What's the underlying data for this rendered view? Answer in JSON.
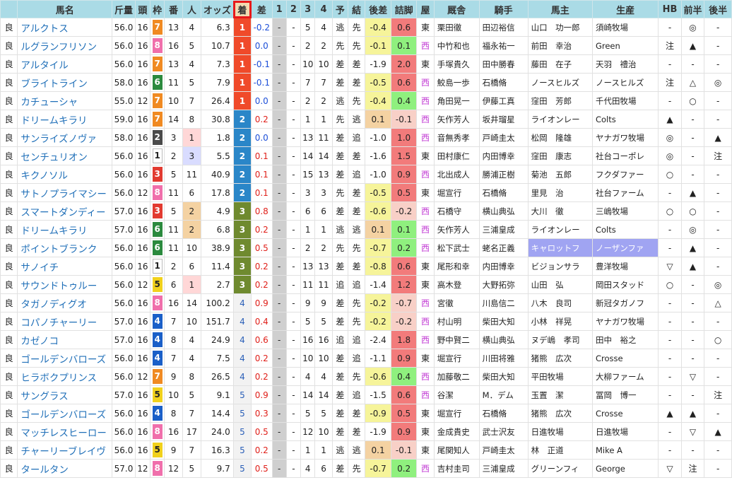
{
  "headers": [
    "馬名",
    "斤量",
    "頭",
    "枠",
    "番",
    "人",
    "オッズ",
    "着",
    "差",
    "1",
    "2",
    "3",
    "4",
    "予",
    "結",
    "後差",
    "詰脚",
    "屋",
    "厩舎",
    "騎手",
    "馬主",
    "生産",
    "HB",
    "前半",
    "後半"
  ],
  "sorted_column": "着",
  "colors": {
    "header": "#aadbe6",
    "sorted_header": "#f2d9b0",
    "sort_outline": "#e8181a",
    "link": "#1f6fb8",
    "west": "#c23bd4"
  },
  "rows": [
    {
      "ground": "良",
      "name": "アルクトス",
      "weight": "56.0",
      "heads": "16",
      "gate": "7",
      "num": "13",
      "pop": "4",
      "odds": "6.3",
      "finish": "1",
      "diff": "-0.2",
      "c1": "-",
      "c2": "-",
      "c3": "5",
      "c4": "4",
      "yosou": "逃",
      "kekka": "先",
      "atosa": "-0.4",
      "tsume": "0.6",
      "ya": "東",
      "trainer": "栗田徹",
      "jockey": "田辺裕信",
      "owner": "山口　功一郎",
      "breeder": "須崎牧場",
      "hb": "-",
      "zen": "◎",
      "kou": "-"
    },
    {
      "ground": "良",
      "name": "ルグランフリソン",
      "weight": "56.0",
      "heads": "16",
      "gate": "8",
      "num": "16",
      "pop": "5",
      "odds": "10.7",
      "finish": "1",
      "diff": "0.0",
      "c1": "-",
      "c2": "-",
      "c3": "2",
      "c4": "2",
      "yosou": "先",
      "kekka": "先",
      "atosa": "-0.1",
      "tsume": "0.1",
      "ya": "西",
      "trainer": "中竹和也",
      "jockey": "福永祐一",
      "owner": "前田　幸治",
      "breeder": "Green",
      "hb": "注",
      "zen": "▲",
      "kou": "-"
    },
    {
      "ground": "良",
      "name": "アルタイル",
      "weight": "56.0",
      "heads": "16",
      "gate": "7",
      "num": "13",
      "pop": "4",
      "odds": "7.3",
      "finish": "1",
      "diff": "-0.1",
      "c1": "-",
      "c2": "-",
      "c3": "10",
      "c4": "10",
      "yosou": "差",
      "kekka": "差",
      "atosa": "-1.9",
      "tsume": "2.0",
      "ya": "東",
      "trainer": "手塚貴久",
      "jockey": "田中勝春",
      "owner": "藤田　在子",
      "breeder": "天羽　禮治",
      "hb": "-",
      "zen": "-",
      "kou": "-"
    },
    {
      "ground": "良",
      "name": "ブライトライン",
      "weight": "58.0",
      "heads": "16",
      "gate": "6",
      "num": "11",
      "pop": "5",
      "odds": "7.9",
      "finish": "1",
      "diff": "-0.1",
      "c1": "-",
      "c2": "-",
      "c3": "7",
      "c4": "7",
      "yosou": "差",
      "kekka": "差",
      "atosa": "-0.5",
      "tsume": "0.6",
      "ya": "西",
      "trainer": "鮫島一歩",
      "jockey": "石橋脩",
      "owner": "ノースヒルズ",
      "breeder": "ノースヒルズ",
      "hb": "注",
      "zen": "△",
      "kou": "◎"
    },
    {
      "ground": "良",
      "name": "カチューシャ",
      "weight": "55.0",
      "heads": "12",
      "gate": "7",
      "num": "10",
      "pop": "7",
      "odds": "26.4",
      "finish": "1",
      "diff": "0.0",
      "c1": "-",
      "c2": "-",
      "c3": "2",
      "c4": "2",
      "yosou": "逃",
      "kekka": "先",
      "atosa": "-0.4",
      "tsume": "0.4",
      "ya": "西",
      "trainer": "角田晃一",
      "jockey": "伊藤工真",
      "owner": "窪田　芳郎",
      "breeder": "千代田牧場",
      "hb": "-",
      "zen": "○",
      "kou": "-"
    },
    {
      "ground": "良",
      "name": "ドリームキラリ",
      "weight": "59.0",
      "heads": "16",
      "gate": "7",
      "num": "14",
      "pop": "8",
      "odds": "30.8",
      "finish": "2",
      "diff": "0.2",
      "c1": "-",
      "c2": "-",
      "c3": "1",
      "c4": "1",
      "yosou": "先",
      "kekka": "逃",
      "atosa": "0.1",
      "tsume": "-0.1",
      "ya": "西",
      "trainer": "矢作芳人",
      "jockey": "坂井瑠星",
      "owner": "ライオンレー",
      "breeder": "Colts",
      "hb": "▲",
      "zen": "-",
      "kou": "-"
    },
    {
      "ground": "良",
      "name": "サンライズノヴァ",
      "weight": "58.0",
      "heads": "16",
      "gate": "2",
      "num": "3",
      "pop": "1",
      "odds": "1.8",
      "finish": "2",
      "diff": "0.0",
      "c1": "-",
      "c2": "-",
      "c3": "13",
      "c4": "11",
      "yosou": "差",
      "kekka": "追",
      "atosa": "-1.0",
      "tsume": "1.0",
      "ya": "西",
      "trainer": "音無秀孝",
      "jockey": "戸崎圭太",
      "owner": "松岡　隆雄",
      "breeder": "ヤナガワ牧場",
      "hb": "◎",
      "zen": "-",
      "kou": "▲"
    },
    {
      "ground": "良",
      "name": "センチュリオン",
      "weight": "56.0",
      "heads": "16",
      "gate": "1",
      "num": "2",
      "pop": "3",
      "odds": "5.5",
      "finish": "2",
      "diff": "0.1",
      "c1": "-",
      "c2": "-",
      "c3": "14",
      "c4": "14",
      "yosou": "差",
      "kekka": "差",
      "atosa": "-1.6",
      "tsume": "1.5",
      "ya": "東",
      "trainer": "田村康仁",
      "jockey": "内田博幸",
      "owner": "窪田　康志",
      "breeder": "社台コーポレ",
      "hb": "◎",
      "zen": "-",
      "kou": "注"
    },
    {
      "ground": "良",
      "name": "キクノソル",
      "weight": "56.0",
      "heads": "16",
      "gate": "3",
      "num": "5",
      "pop": "11",
      "odds": "40.9",
      "finish": "2",
      "diff": "0.1",
      "c1": "-",
      "c2": "-",
      "c3": "15",
      "c4": "13",
      "yosou": "差",
      "kekka": "追",
      "atosa": "-1.0",
      "tsume": "0.9",
      "ya": "西",
      "trainer": "北出成人",
      "jockey": "勝浦正樹",
      "owner": "菊池　五郎",
      "breeder": "フクダファー",
      "hb": "○",
      "zen": "-",
      "kou": "-"
    },
    {
      "ground": "良",
      "name": "サトノプライマシー",
      "weight": "56.0",
      "heads": "12",
      "gate": "8",
      "num": "11",
      "pop": "6",
      "odds": "17.8",
      "finish": "2",
      "diff": "0.1",
      "c1": "-",
      "c2": "-",
      "c3": "3",
      "c4": "3",
      "yosou": "先",
      "kekka": "差",
      "atosa": "-0.5",
      "tsume": "0.5",
      "ya": "東",
      "trainer": "堀宣行",
      "jockey": "石橋脩",
      "owner": "里見　治",
      "breeder": "社台ファーム",
      "hb": "-",
      "zen": "▲",
      "kou": "-"
    },
    {
      "ground": "良",
      "name": "スマートダンディー",
      "weight": "57.0",
      "heads": "16",
      "gate": "3",
      "num": "5",
      "pop": "2",
      "odds": "4.9",
      "finish": "3",
      "diff": "0.8",
      "c1": "-",
      "c2": "-",
      "c3": "6",
      "c4": "6",
      "yosou": "差",
      "kekka": "差",
      "atosa": "-0.6",
      "tsume": "-0.2",
      "ya": "西",
      "trainer": "石橋守",
      "jockey": "横山典弘",
      "owner": "大川　徹",
      "breeder": "三嶋牧場",
      "hb": "○",
      "zen": "○",
      "kou": "-"
    },
    {
      "ground": "良",
      "name": "ドリームキラリ",
      "weight": "57.0",
      "heads": "16",
      "gate": "6",
      "num": "11",
      "pop": "2",
      "odds": "6.8",
      "finish": "3",
      "diff": "0.2",
      "c1": "-",
      "c2": "-",
      "c3": "1",
      "c4": "1",
      "yosou": "逃",
      "kekka": "逃",
      "atosa": "0.1",
      "tsume": "0.1",
      "ya": "西",
      "trainer": "矢作芳人",
      "jockey": "三浦皇成",
      "owner": "ライオンレー",
      "breeder": "Colts",
      "hb": "-",
      "zen": "◎",
      "kou": "-"
    },
    {
      "ground": "良",
      "name": "ポイントブランク",
      "weight": "56.0",
      "heads": "16",
      "gate": "6",
      "num": "11",
      "pop": "10",
      "odds": "38.9",
      "finish": "3",
      "diff": "0.5",
      "c1": "-",
      "c2": "-",
      "c3": "2",
      "c4": "2",
      "yosou": "先",
      "kekka": "先",
      "atosa": "-0.7",
      "tsume": "0.2",
      "ya": "西",
      "trainer": "松下武士",
      "jockey": "蛯名正義",
      "owner": "キャロットフ",
      "breeder": "ノーザンファ",
      "hb": "-",
      "zen": "▲",
      "kou": "-"
    },
    {
      "ground": "良",
      "name": "サノイチ",
      "weight": "56.0",
      "heads": "16",
      "gate": "1",
      "num": "2",
      "pop": "6",
      "odds": "11.4",
      "finish": "3",
      "diff": "0.2",
      "c1": "-",
      "c2": "-",
      "c3": "13",
      "c4": "13",
      "yosou": "差",
      "kekka": "差",
      "atosa": "-0.8",
      "tsume": "0.6",
      "ya": "東",
      "trainer": "尾形和幸",
      "jockey": "内田博幸",
      "owner": "ビジョンサラ",
      "breeder": "豊洋牧場",
      "hb": "▽",
      "zen": "▲",
      "kou": "-"
    },
    {
      "ground": "良",
      "name": "サウンドトゥルー",
      "weight": "56.0",
      "heads": "12",
      "gate": "5",
      "num": "6",
      "pop": "1",
      "odds": "2.7",
      "finish": "3",
      "diff": "0.2",
      "c1": "-",
      "c2": "-",
      "c3": "11",
      "c4": "11",
      "yosou": "追",
      "kekka": "追",
      "atosa": "-1.4",
      "tsume": "1.2",
      "ya": "東",
      "trainer": "高木登",
      "jockey": "大野拓弥",
      "owner": "山田　弘",
      "breeder": "岡田スタッド",
      "hb": "○",
      "zen": "-",
      "kou": "◎"
    },
    {
      "ground": "良",
      "name": "タガノディグオ",
      "weight": "56.0",
      "heads": "16",
      "gate": "8",
      "num": "16",
      "pop": "14",
      "odds": "100.2",
      "finish": "4",
      "diff": "0.9",
      "c1": "-",
      "c2": "-",
      "c3": "9",
      "c4": "9",
      "yosou": "差",
      "kekka": "先",
      "atosa": "-0.2",
      "tsume": "-0.7",
      "ya": "西",
      "trainer": "宮徹",
      "jockey": "川島信二",
      "owner": "八木　良司",
      "breeder": "新冠タガノフ",
      "hb": "-",
      "zen": "-",
      "kou": "△"
    },
    {
      "ground": "良",
      "name": "コパノチャーリー",
      "weight": "57.0",
      "heads": "16",
      "gate": "4",
      "num": "7",
      "pop": "10",
      "odds": "151.7",
      "finish": "4",
      "diff": "0.4",
      "c1": "-",
      "c2": "-",
      "c3": "5",
      "c4": "5",
      "yosou": "差",
      "kekka": "先",
      "atosa": "-0.2",
      "tsume": "-0.2",
      "ya": "西",
      "trainer": "村山明",
      "jockey": "柴田大知",
      "owner": "小林　祥晃",
      "breeder": "ヤナガワ牧場",
      "hb": "-",
      "zen": "-",
      "kou": "-"
    },
    {
      "ground": "良",
      "name": "カゼノコ",
      "weight": "57.0",
      "heads": "16",
      "gate": "4",
      "num": "8",
      "pop": "4",
      "odds": "24.9",
      "finish": "4",
      "diff": "0.6",
      "c1": "-",
      "c2": "-",
      "c3": "16",
      "c4": "16",
      "yosou": "追",
      "kekka": "追",
      "atosa": "-2.4",
      "tsume": "1.8",
      "ya": "西",
      "trainer": "野中賢二",
      "jockey": "横山典弘",
      "owner": "ヌデ嶋　孝司",
      "breeder": "田中　裕之",
      "hb": "-",
      "zen": "-",
      "kou": "○"
    },
    {
      "ground": "良",
      "name": "ゴールデンバローズ",
      "weight": "56.0",
      "heads": "16",
      "gate": "4",
      "num": "7",
      "pop": "4",
      "odds": "7.5",
      "finish": "4",
      "diff": "0.2",
      "c1": "-",
      "c2": "-",
      "c3": "10",
      "c4": "10",
      "yosou": "差",
      "kekka": "追",
      "atosa": "-1.1",
      "tsume": "0.9",
      "ya": "東",
      "trainer": "堀宣行",
      "jockey": "川田将雅",
      "owner": "猪熊　広次",
      "breeder": "Crosse",
      "hb": "-",
      "zen": "-",
      "kou": "-"
    },
    {
      "ground": "良",
      "name": "ヒラボクプリンス",
      "weight": "56.0",
      "heads": "12",
      "gate": "7",
      "num": "9",
      "pop": "8",
      "odds": "26.5",
      "finish": "4",
      "diff": "0.2",
      "c1": "-",
      "c2": "-",
      "c3": "4",
      "c4": "4",
      "yosou": "差",
      "kekka": "先",
      "atosa": "-0.6",
      "tsume": "0.4",
      "ya": "西",
      "trainer": "加藤敬二",
      "jockey": "柴田大知",
      "owner": "平田牧場",
      "breeder": "大柳ファーム",
      "hb": "-",
      "zen": "▽",
      "kou": "-"
    },
    {
      "ground": "良",
      "name": "サングラス",
      "weight": "57.0",
      "heads": "16",
      "gate": "5",
      "num": "10",
      "pop": "5",
      "odds": "9.1",
      "finish": "5",
      "diff": "0.9",
      "c1": "-",
      "c2": "-",
      "c3": "14",
      "c4": "14",
      "yosou": "差",
      "kekka": "追",
      "atosa": "-1.5",
      "tsume": "0.6",
      "ya": "西",
      "trainer": "谷潔",
      "jockey": "M．デム",
      "owner": "玉置　潔",
      "breeder": "冨岡　博一",
      "hb": "-",
      "zen": "-",
      "kou": "注"
    },
    {
      "ground": "良",
      "name": "ゴールデンバローズ",
      "weight": "56.0",
      "heads": "16",
      "gate": "4",
      "num": "8",
      "pop": "7",
      "odds": "14.4",
      "finish": "5",
      "diff": "0.3",
      "c1": "-",
      "c2": "-",
      "c3": "5",
      "c4": "5",
      "yosou": "差",
      "kekka": "差",
      "atosa": "-0.9",
      "tsume": "0.5",
      "ya": "東",
      "trainer": "堀宣行",
      "jockey": "石橋脩",
      "owner": "猪熊　広次",
      "breeder": "Crosse",
      "hb": "▲",
      "zen": "▲",
      "kou": "-"
    },
    {
      "ground": "良",
      "name": "マッチレスヒーロー",
      "weight": "56.0",
      "heads": "16",
      "gate": "8",
      "num": "16",
      "pop": "17",
      "odds": "24.0",
      "finish": "5",
      "diff": "0.5",
      "c1": "-",
      "c2": "-",
      "c3": "12",
      "c4": "10",
      "yosou": "差",
      "kekka": "差",
      "atosa": "-1.9",
      "tsume": "0.9",
      "ya": "東",
      "trainer": "金成貴史",
      "jockey": "武士沢友",
      "owner": "日進牧場",
      "breeder": "日進牧場",
      "hb": "-",
      "zen": "▽",
      "kou": "▲"
    },
    {
      "ground": "良",
      "name": "チャーリーブレイヴ",
      "weight": "56.0",
      "heads": "16",
      "gate": "5",
      "num": "9",
      "pop": "7",
      "odds": "16.3",
      "finish": "5",
      "diff": "0.2",
      "c1": "-",
      "c2": "-",
      "c3": "1",
      "c4": "1",
      "yosou": "逃",
      "kekka": "逃",
      "atosa": "0.1",
      "tsume": "-0.1",
      "ya": "東",
      "trainer": "尾関知人",
      "jockey": "戸崎圭太",
      "owner": "林　正道",
      "breeder": "Mike A",
      "hb": "-",
      "zen": "-",
      "kou": "-"
    },
    {
      "ground": "良",
      "name": "タールタン",
      "weight": "57.0",
      "heads": "12",
      "gate": "8",
      "num": "12",
      "pop": "5",
      "odds": "9.7",
      "finish": "5",
      "diff": "0.5",
      "c1": "-",
      "c2": "-",
      "c3": "4",
      "c4": "6",
      "yosou": "差",
      "kekka": "先",
      "atosa": "-0.7",
      "tsume": "0.2",
      "ya": "西",
      "trainer": "吉村圭司",
      "jockey": "三浦皇成",
      "owner": "グリーンフィ",
      "breeder": "George",
      "hb": "▽",
      "zen": "注",
      "kou": "-"
    }
  ]
}
